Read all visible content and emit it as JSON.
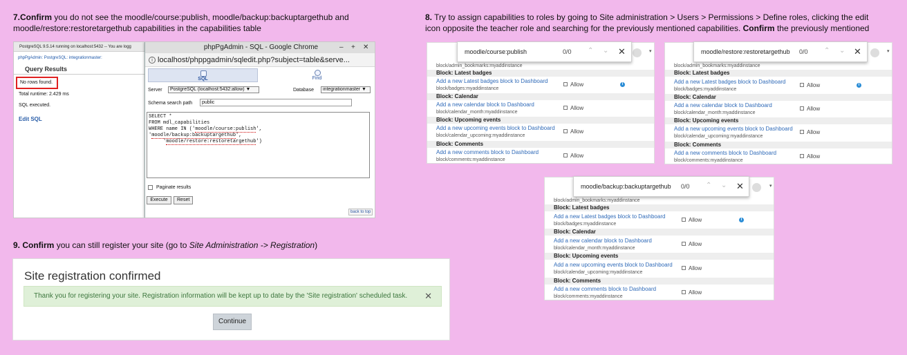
{
  "steps": {
    "s7": {
      "num": "7.",
      "strong": "Confirm",
      "line1": " you do not see the moodle/course:publish, moodle/backup:backuptargethub and",
      "line2": "moodle/restore:restoretargethub  capabilities in the capabilities table"
    },
    "s8": {
      "num": "8.",
      "line1": " Try to assign capabilities to roles by going to Site administration > Users > Permissions > Define roles, clicking the edit",
      "line2a": "icon opposite the teacher role and searching for the previously mentioned capabilities. ",
      "strong": "Confirm",
      "line2b": " the previously mentioned"
    },
    "s9": {
      "num": "9.",
      "strong": "Confirm",
      "mid": " you can still register your site (go to ",
      "ital": "Site Administration  -> Registration",
      "end": ")"
    }
  },
  "pg": {
    "topbar": "PostgreSQL 9.5.14 running on localhost:5432 -- You are logg",
    "crumb_a": "phpPgAdmin:",
    "crumb_b": "PostgreSQL:",
    "crumb_c": "integrationmaster:",
    "query_results": "Query Results",
    "no_rows": "No rows found.",
    "runtime": "Total runtime: 2.429 ms",
    "executed": "SQL executed.",
    "edit_sql": "Edit SQL"
  },
  "chrome": {
    "title": "phpPgAdmin - SQL - Google Chrome",
    "min": "–",
    "max": "+",
    "close": "✕",
    "url": "localhost/phppgadmin/sqledit.php?subject=table&serve...",
    "tab_sql": "SQL",
    "tab_find": "Find",
    "server_label": "Server",
    "server_value": "PostgreSQL (localhost:5432:allow) ▼",
    "database_label": "Database",
    "database_value": "integrationmaster ▼",
    "schema_label": "Schema search path",
    "schema_value": "public",
    "sql_l1": "SELECT *",
    "sql_l2": "FROM mdl_capabilities",
    "sql_l3a": "WHERE name IN ('",
    "sql_l3b": "moodle/course:publish",
    "sql_l3c": "',",
    "sql_l4a": "'",
    "sql_l4b": "moodle/backup:backuptargethub",
    "sql_l4c": "',",
    "sql_l5a": "     '",
    "sql_l5b": "moodle/restore:restoretargethub",
    "sql_l5c": "')",
    "paginate": "Paginate results",
    "execute": "Execute",
    "reset": "Reset",
    "back_to_top": "back to top"
  },
  "moodle_rows": {
    "top_path": "block/admin_bookmarks:myaddinstance",
    "latest_h": "Block: Latest badges",
    "latest_link": "Add a new Latest badges block to Dashboard",
    "latest_path": "block/badges:myaddinstance",
    "cal_h": "Block: Calendar",
    "cal_link": "Add a new calendar block to Dashboard",
    "cal_path": "block/calendar_month:myaddinstance",
    "up_h": "Block: Upcoming events",
    "up_link": "Add a new upcoming events block to Dashboard",
    "up_path": "block/calendar_upcoming:myaddinstance",
    "com_h": "Block: Comments",
    "com_link": "Add a new comments block to Dashboard",
    "com_path": "block/comments:myaddinstance",
    "allow": "Allow",
    "info": "i"
  },
  "searches": {
    "a": {
      "query": "moodle/course:publish",
      "count": "0/0"
    },
    "b": {
      "query": "moodle/restore:restoretargethub",
      "count": "0/0"
    },
    "c": {
      "query": "moodle/backup:backuptargethub",
      "count": "0/0"
    },
    "up": "⌃",
    "down": "⌄",
    "close": "✕"
  },
  "registration": {
    "title": "Site registration confirmed",
    "message": "Thank you for registering your site. Registration information will be kept up to date by the 'Site registration' scheduled task.",
    "close": "✕",
    "button": "Continue"
  }
}
